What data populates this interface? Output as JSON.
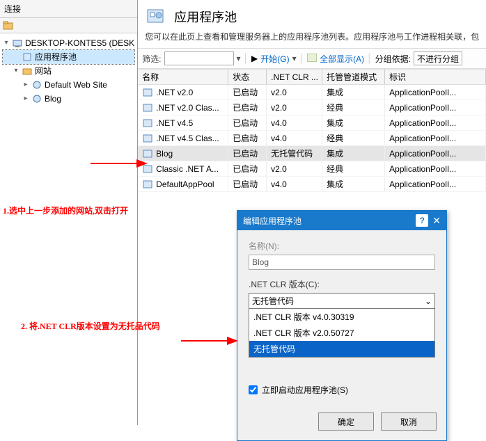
{
  "leftTitle": "连接",
  "tree": {
    "root": "DESKTOP-KONTES5 (DESK",
    "appPools": "应用程序池",
    "sites": "网站",
    "site1": "Default Web Site",
    "site2": "Blog"
  },
  "page": {
    "title": "应用程序池",
    "desc": "您可以在此页上查看和管理服务器上的应用程序池列表。应用程序池与工作进程相关联，包"
  },
  "filter": {
    "label": "筛选:",
    "go": "开始(G)",
    "showAll": "全部显示(A)",
    "groupBy": "分组依据:",
    "noGroup": "不进行分组"
  },
  "cols": {
    "c1": "名称",
    "c2": "状态",
    "c3": ".NET CLR ...",
    "c4": "托管管道模式",
    "c5": "标识"
  },
  "rows": [
    {
      "name": ".NET v2.0",
      "status": "已启动",
      "clr": "v2.0",
      "mode": "集成",
      "id": "ApplicationPoolI..."
    },
    {
      "name": ".NET v2.0 Clas...",
      "status": "已启动",
      "clr": "v2.0",
      "mode": "经典",
      "id": "ApplicationPoolI..."
    },
    {
      "name": ".NET v4.5",
      "status": "已启动",
      "clr": "v4.0",
      "mode": "集成",
      "id": "ApplicationPoolI..."
    },
    {
      "name": ".NET v4.5 Clas...",
      "status": "已启动",
      "clr": "v4.0",
      "mode": "经典",
      "id": "ApplicationPoolI..."
    },
    {
      "name": "Blog",
      "status": "已启动",
      "clr": "无托管代码",
      "mode": "集成",
      "id": "ApplicationPoolI..."
    },
    {
      "name": "Classic .NET A...",
      "status": "已启动",
      "clr": "v2.0",
      "mode": "经典",
      "id": "ApplicationPoolI..."
    },
    {
      "name": "DefaultAppPool",
      "status": "已启动",
      "clr": "v4.0",
      "mode": "集成",
      "id": "ApplicationPoolI..."
    }
  ],
  "dialog": {
    "title": "编辑应用程序池",
    "nameLabel": "名称(N):",
    "nameValue": "Blog",
    "clrLabel": ".NET CLR 版本(C):",
    "clrValue": "无托管代码",
    "opts": [
      ".NET CLR 版本 v4.0.30319",
      ".NET CLR 版本 v2.0.50727",
      "无托管代码"
    ],
    "check": "立即启动应用程序池(S)",
    "ok": "确定",
    "cancel": "取消"
  },
  "annot": {
    "a1": "1.选中上一步添加的网站,双击打开",
    "a2": "2. 将.NET CLR版本设置为无托品代码"
  }
}
